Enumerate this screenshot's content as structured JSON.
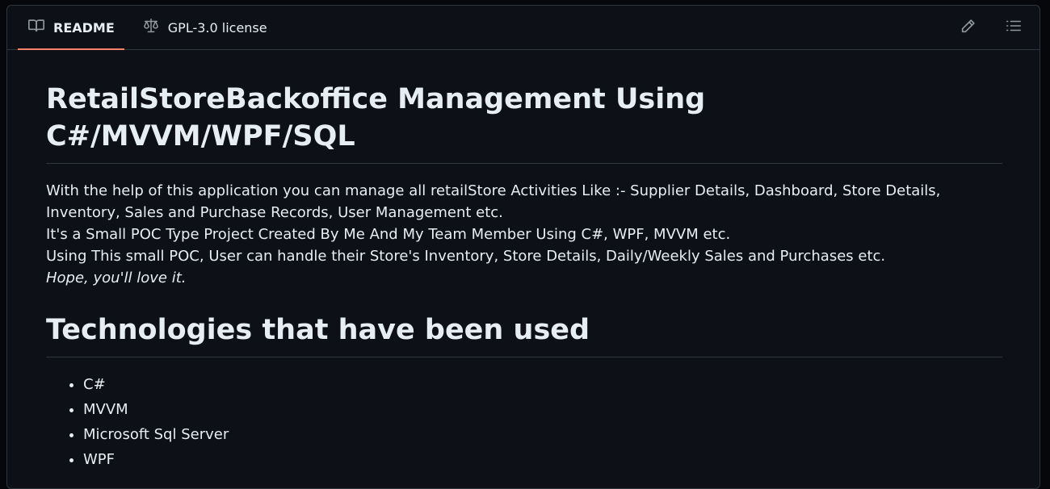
{
  "tabs": [
    {
      "label": "README",
      "icon": "book-icon",
      "active": true
    },
    {
      "label": "GPL-3.0 license",
      "icon": "scale-icon",
      "active": false
    }
  ],
  "toolbar": {
    "edit_icon": "pencil-icon",
    "outline_icon": "list-icon"
  },
  "readme": {
    "title_line1": "RetailStoreBackoffice Management Using",
    "title_line2": "C#/MVVM/WPF/SQL",
    "paragraph": {
      "line1": "With the help of this application you can manage all retailStore Activities Like :- Supplier Details, Dashboard, Store Details, Inventory, Sales and Purchase Records, User Management etc.",
      "line2": "It's a Small POC Type Project Created By Me And My Team Member Using C#, WPF, MVVM etc.",
      "line3": "Using This small POC, User can handle their Store's Inventory, Store Details, Daily/Weekly Sales and Purchases etc.",
      "line4": "Hope, you'll love it."
    },
    "tech_heading": "Technologies that have been used",
    "technologies": [
      "C#",
      "MVVM",
      "Microsoft Sql Server",
      "WPF"
    ]
  },
  "colors": {
    "background": "#0d1117",
    "border": "#30363d",
    "text": "#e6edf3",
    "active_tab_underline": "#f78166"
  }
}
